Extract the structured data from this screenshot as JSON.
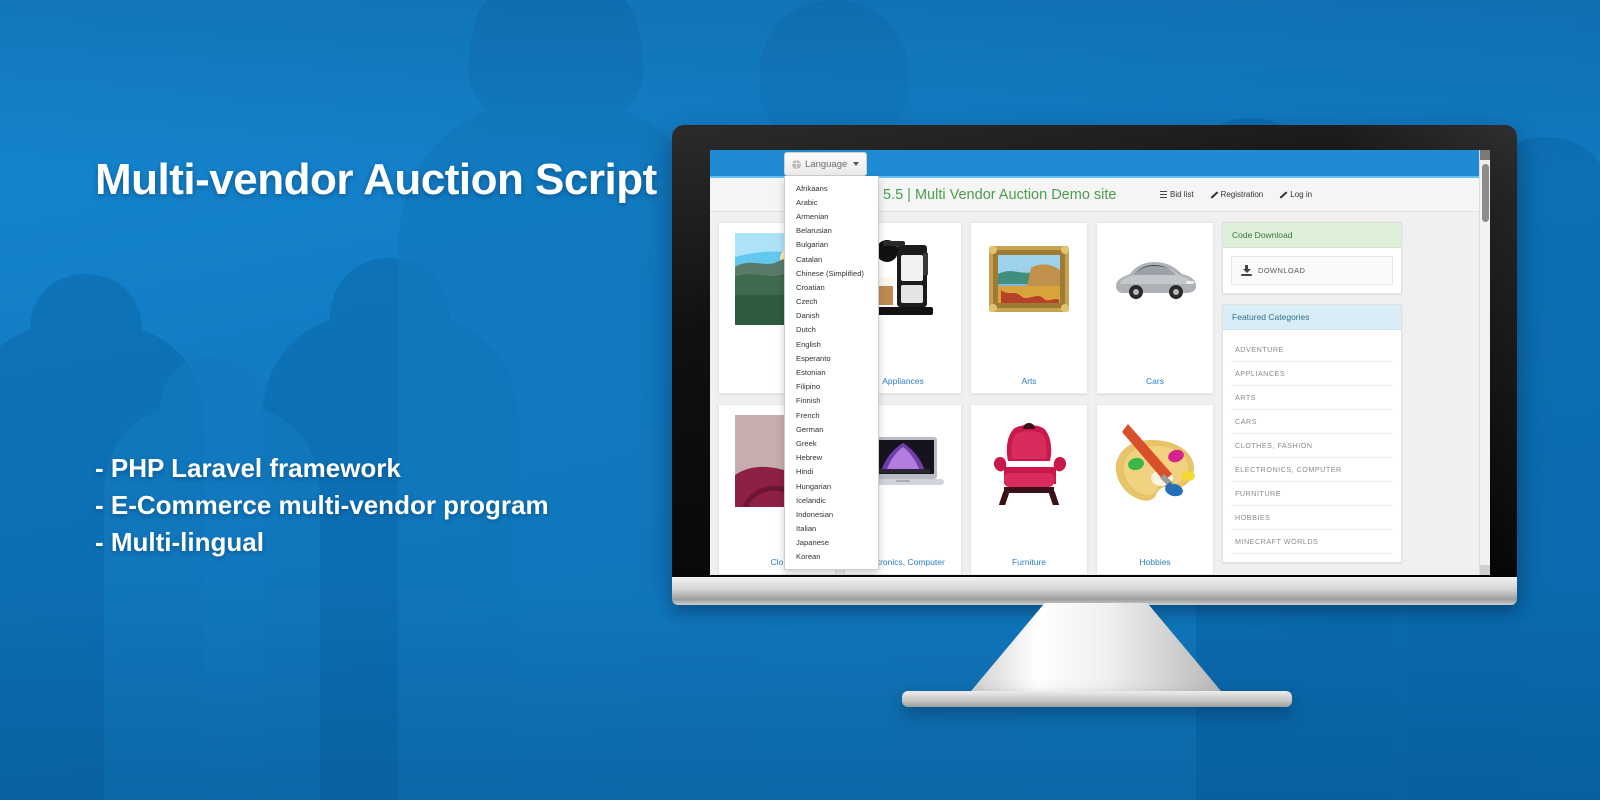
{
  "hero": {
    "headline": "Multi-vendor Auction Script",
    "bullets": [
      "- PHP Laravel framework",
      "- E-Commerce multi-vendor program",
      "- Multi-lingual"
    ],
    "background_color": "#0f7ac4",
    "headline_color": "#ffffff"
  },
  "browser": {
    "navbar": {
      "background_color": "#1e8bd4",
      "language_button": {
        "label": "Language",
        "icon": "globe-icon",
        "caret": "chevron-down-icon"
      }
    },
    "header": {
      "site_title": "5.5 | Multi Vendor Auction Demo site",
      "site_title_color": "#4c9e4c",
      "links": [
        {
          "label": "Bid list",
          "icon": "list-icon"
        },
        {
          "label": "Registration",
          "icon": "pencil-icon"
        },
        {
          "label": "Log in",
          "icon": "pencil-icon"
        }
      ]
    },
    "language_menu": {
      "open": true,
      "options": [
        "Afrikaans",
        "Arabic",
        "Armenian",
        "Belarusian",
        "Bulgarian",
        "Catalan",
        "Chinese (Simplified)",
        "Croatian",
        "Czech",
        "Danish",
        "Dutch",
        "English",
        "Esperanto",
        "Estonian",
        "Filipino",
        "Finnish",
        "French",
        "German",
        "Greek",
        "Hebrew",
        "Hindi",
        "Hungarian",
        "Icelandic",
        "Indonesian",
        "Italian",
        "Japanese",
        "Korean"
      ]
    },
    "categories_grid": {
      "hidden_column": [
        {
          "label": "",
          "thumb": "landscape-photo"
        },
        {
          "label": "Clo",
          "thumb": "clothes-photo"
        }
      ],
      "columns": [
        [
          {
            "label": "Appliances",
            "thumb": "coffee-machine"
          },
          {
            "label": "Electronics, Computer",
            "thumb": "laptop"
          }
        ],
        [
          {
            "label": "Arts",
            "thumb": "framed-painting"
          },
          {
            "label": "Furniture",
            "thumb": "armchair"
          }
        ],
        [
          {
            "label": "Cars",
            "thumb": "silver-sedan"
          },
          {
            "label": "Hobbies",
            "thumb": "paint-palette"
          }
        ]
      ]
    },
    "sidebar": {
      "code_download": {
        "title": "Code Download",
        "button_label": "DOWNLOAD",
        "button_icon": "download-icon",
        "header_color": "#dff0d8"
      },
      "featured_categories": {
        "title": "Featured Categories",
        "header_color": "#d9edf7",
        "items": [
          "ADVENTURE",
          "APPLIANCES",
          "ARTS",
          "CARS",
          "CLOTHES, FASHION",
          "ELECTRONICS, COMPUTER",
          "FURNITURE",
          "HOBBIES",
          "MINECRAFT WORLDS"
        ]
      }
    }
  }
}
